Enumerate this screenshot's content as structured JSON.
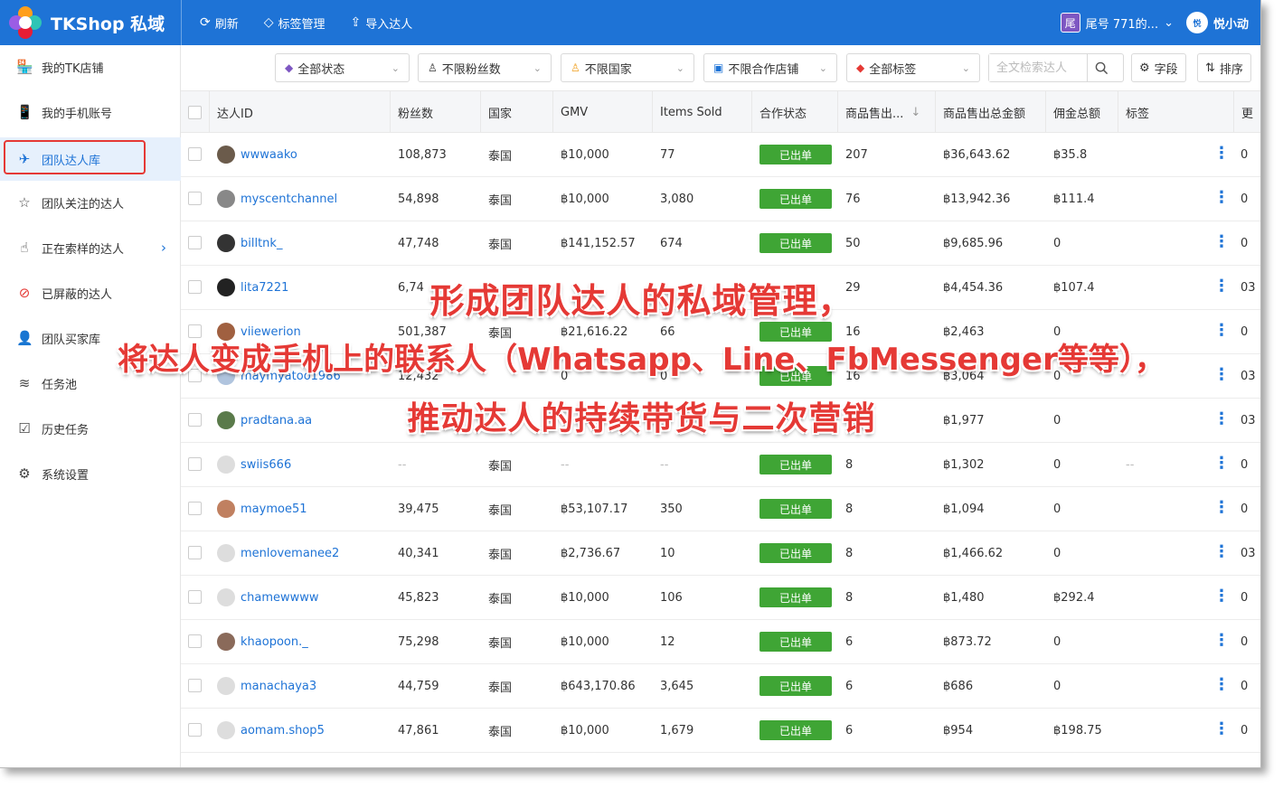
{
  "app": {
    "title": "TKShop 私域"
  },
  "topnav": [
    {
      "icon": "⟳",
      "label": "刷新"
    },
    {
      "icon": "◇",
      "label": "标签管理"
    },
    {
      "icon": "⇪",
      "label": "导入达人"
    }
  ],
  "account": {
    "badge": "尾",
    "label": "尾号 771的...",
    "user": "悦小动",
    "avatar_text": "悦"
  },
  "sidebar": {
    "items": [
      {
        "icon": "🏪",
        "label": "我的TK店铺"
      },
      {
        "icon": "📱",
        "label": "我的手机账号"
      },
      {
        "icon": "✈",
        "label": "团队达人库"
      },
      {
        "icon": "☆",
        "label": "团队关注的达人"
      },
      {
        "icon": "☝",
        "label": "正在索样的达人"
      },
      {
        "icon": "⊘",
        "label": "已屏蔽的达人"
      },
      {
        "icon": "👤",
        "label": "团队买家库"
      },
      {
        "icon": "≋",
        "label": "任务池"
      },
      {
        "icon": "☑",
        "label": "历史任务"
      },
      {
        "icon": "⚙",
        "label": "系统设置"
      }
    ],
    "active_index": 2
  },
  "filters": {
    "status": "全部状态",
    "fans": "不限粉丝数",
    "country": "不限国家",
    "shop": "不限合作店铺",
    "tags": "全部标签",
    "search_placeholder": "全文检索达人",
    "fields": "字段",
    "sort": "排序"
  },
  "table": {
    "columns": [
      "达人ID",
      "粉丝数",
      "国家",
      "GMV",
      "Items Sold",
      "合作状态",
      "商品售出...",
      "商品售出总金额",
      "佣金总额",
      "标签",
      "更"
    ],
    "rows": [
      {
        "id": "wwwaako",
        "fans": "108,873",
        "country": "泰国",
        "gmv": "฿10,000",
        "sold": "77",
        "status": "已出单",
        "sold_cnt": "207",
        "sold_amt": "฿36,643.62",
        "commission": "฿35.8",
        "tag": "",
        "more": "0"
      },
      {
        "id": "myscentchannel",
        "fans": "54,898",
        "country": "泰国",
        "gmv": "฿10,000",
        "sold": "3,080",
        "status": "已出单",
        "sold_cnt": "76",
        "sold_amt": "฿13,942.36",
        "commission": "฿111.4",
        "tag": "",
        "more": "0"
      },
      {
        "id": "billtnk_",
        "fans": "47,748",
        "country": "泰国",
        "gmv": "฿141,152.57",
        "sold": "674",
        "status": "已出单",
        "sold_cnt": "50",
        "sold_amt": "฿9,685.96",
        "commission": "0",
        "tag": "",
        "more": "0"
      },
      {
        "id": "lita7221",
        "fans": "6,74",
        "country": "",
        "gmv": "",
        "sold": "",
        "status": "",
        "sold_cnt": "29",
        "sold_amt": "฿4,454.36",
        "commission": "฿107.4",
        "tag": "",
        "more": "03"
      },
      {
        "id": "viiewerion",
        "fans": "501,387",
        "country": "泰国",
        "gmv": "฿21,616.22",
        "sold": "66",
        "status": "已出单",
        "sold_cnt": "16",
        "sold_amt": "฿2,463",
        "commission": "0",
        "tag": "",
        "more": "0"
      },
      {
        "id": "maymyatoo1986",
        "fans": "12,432",
        "country": "",
        "gmv": "0",
        "sold": "0",
        "status": "已出单",
        "sold_cnt": "16",
        "sold_amt": "฿3,064",
        "commission": "0",
        "tag": "",
        "more": "03"
      },
      {
        "id": "pradtana.aa",
        "fans": "",
        "country": "",
        "gmv": "",
        "sold": "",
        "status": "",
        "sold_cnt": "",
        "sold_amt": "฿1,977",
        "commission": "0",
        "tag": "",
        "more": "03"
      },
      {
        "id": "swiis666",
        "fans": "--",
        "country": "泰国",
        "gmv": "--",
        "sold": "--",
        "status": "已出单",
        "sold_cnt": "8",
        "sold_amt": "฿1,302",
        "commission": "0",
        "tag": "--",
        "more": "0"
      },
      {
        "id": "maymoe51",
        "fans": "39,475",
        "country": "泰国",
        "gmv": "฿53,107.17",
        "sold": "350",
        "status": "已出单",
        "sold_cnt": "8",
        "sold_amt": "฿1,094",
        "commission": "0",
        "tag": "",
        "more": "0"
      },
      {
        "id": "menlovemanee2",
        "fans": "40,341",
        "country": "泰国",
        "gmv": "฿2,736.67",
        "sold": "10",
        "status": "已出单",
        "sold_cnt": "8",
        "sold_amt": "฿1,466.62",
        "commission": "0",
        "tag": "",
        "more": "03"
      },
      {
        "id": "chamewwww",
        "fans": "45,823",
        "country": "泰国",
        "gmv": "฿10,000",
        "sold": "106",
        "status": "已出单",
        "sold_cnt": "8",
        "sold_amt": "฿1,480",
        "commission": "฿292.4",
        "tag": "",
        "more": "0"
      },
      {
        "id": "khaopoon._",
        "fans": "75,298",
        "country": "泰国",
        "gmv": "฿10,000",
        "sold": "12",
        "status": "已出单",
        "sold_cnt": "6",
        "sold_amt": "฿873.72",
        "commission": "0",
        "tag": "",
        "more": "0"
      },
      {
        "id": "manachaya3",
        "fans": "44,759",
        "country": "泰国",
        "gmv": "฿643,170.86",
        "sold": "3,645",
        "status": "已出单",
        "sold_cnt": "6",
        "sold_amt": "฿686",
        "commission": "0",
        "tag": "",
        "more": "0"
      },
      {
        "id": "aomam.shop5",
        "fans": "47,861",
        "country": "泰国",
        "gmv": "฿10,000",
        "sold": "1,679",
        "status": "已出单",
        "sold_cnt": "6",
        "sold_amt": "฿954",
        "commission": "฿198.75",
        "tag": "",
        "more": "0"
      }
    ]
  },
  "overlay": {
    "line1": "形成团队达人的私域管理，",
    "line2": "将达人变成手机上的联系人（Whatsapp、Line、FbMessenger等等），",
    "line3": "推动达人的持续带货与二次营销"
  },
  "colors": {
    "header": "#1e73d6",
    "link": "#1e73d6",
    "status_green": "#3fa535",
    "overlay_red": "#e53935",
    "highlight_box": "#e53935"
  }
}
